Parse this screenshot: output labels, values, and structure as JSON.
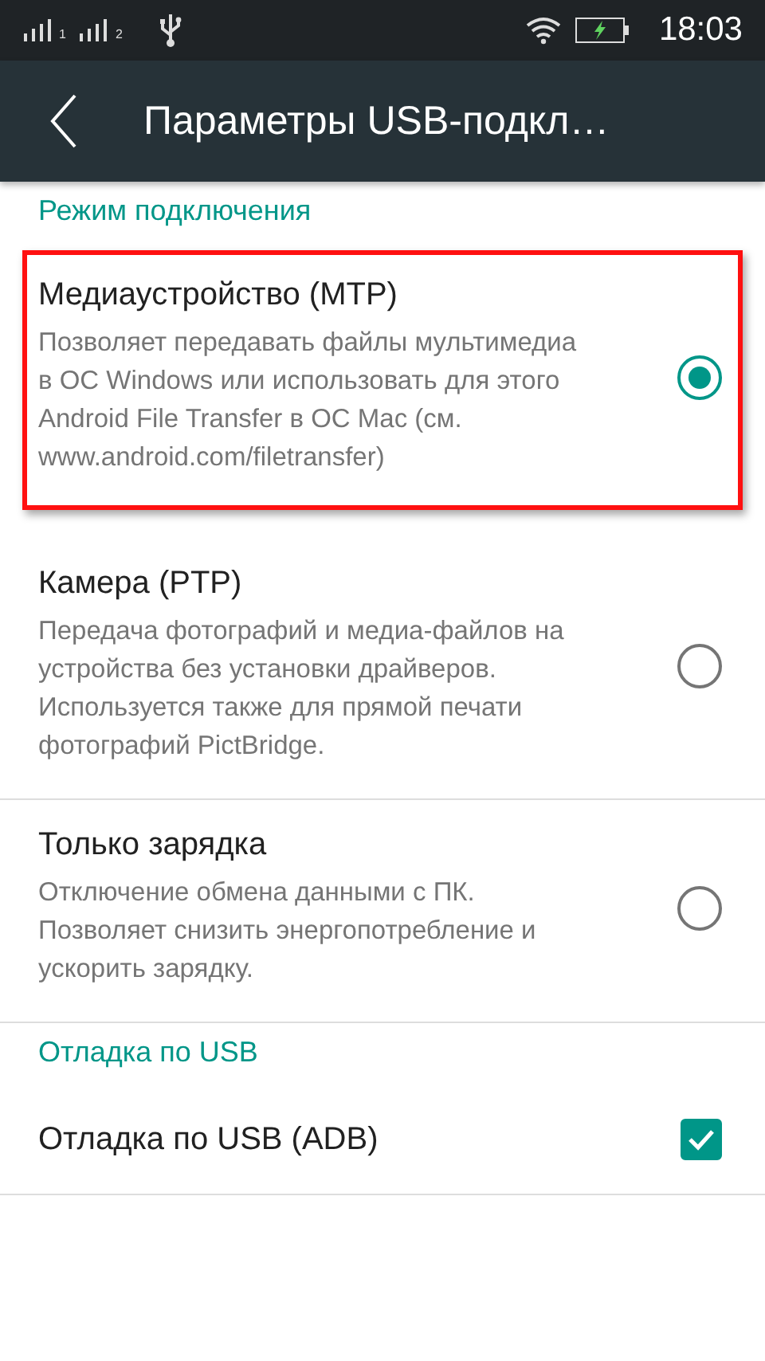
{
  "status_bar": {
    "sims": [
      {
        "label": "1"
      },
      {
        "label": "2"
      }
    ],
    "time": "18:03"
  },
  "app_bar": {
    "title": "Параметры USB-подкл…"
  },
  "sections": [
    {
      "header": "Режим подключения",
      "items": [
        {
          "kind": "radio",
          "title": "Медиаустройство (MTP)",
          "summary": "Позволяет передавать файлы мультимедиа в ОС Windows или использовать для этого Android File Transfer в ОС Mac (см. www.android.com/filetransfer)",
          "selected": true,
          "highlighted": true
        },
        {
          "kind": "radio",
          "title": "Камера (PTP)",
          "summary": "Передача фотографий и медиа-файлов на устройства без установки драйверов. Используется также для прямой печати фотографий PictBridge.",
          "selected": false,
          "highlighted": false
        },
        {
          "kind": "radio",
          "title": "Только зарядка",
          "summary": "Отключение обмена данными с ПК. Позволяет снизить энергопотребление и ускорить зарядку.",
          "selected": false,
          "highlighted": false
        }
      ]
    },
    {
      "header": "Отладка по USB",
      "items": [
        {
          "kind": "checkbox",
          "title": "Отладка по USB (ADB)",
          "checked": true
        }
      ]
    }
  ]
}
